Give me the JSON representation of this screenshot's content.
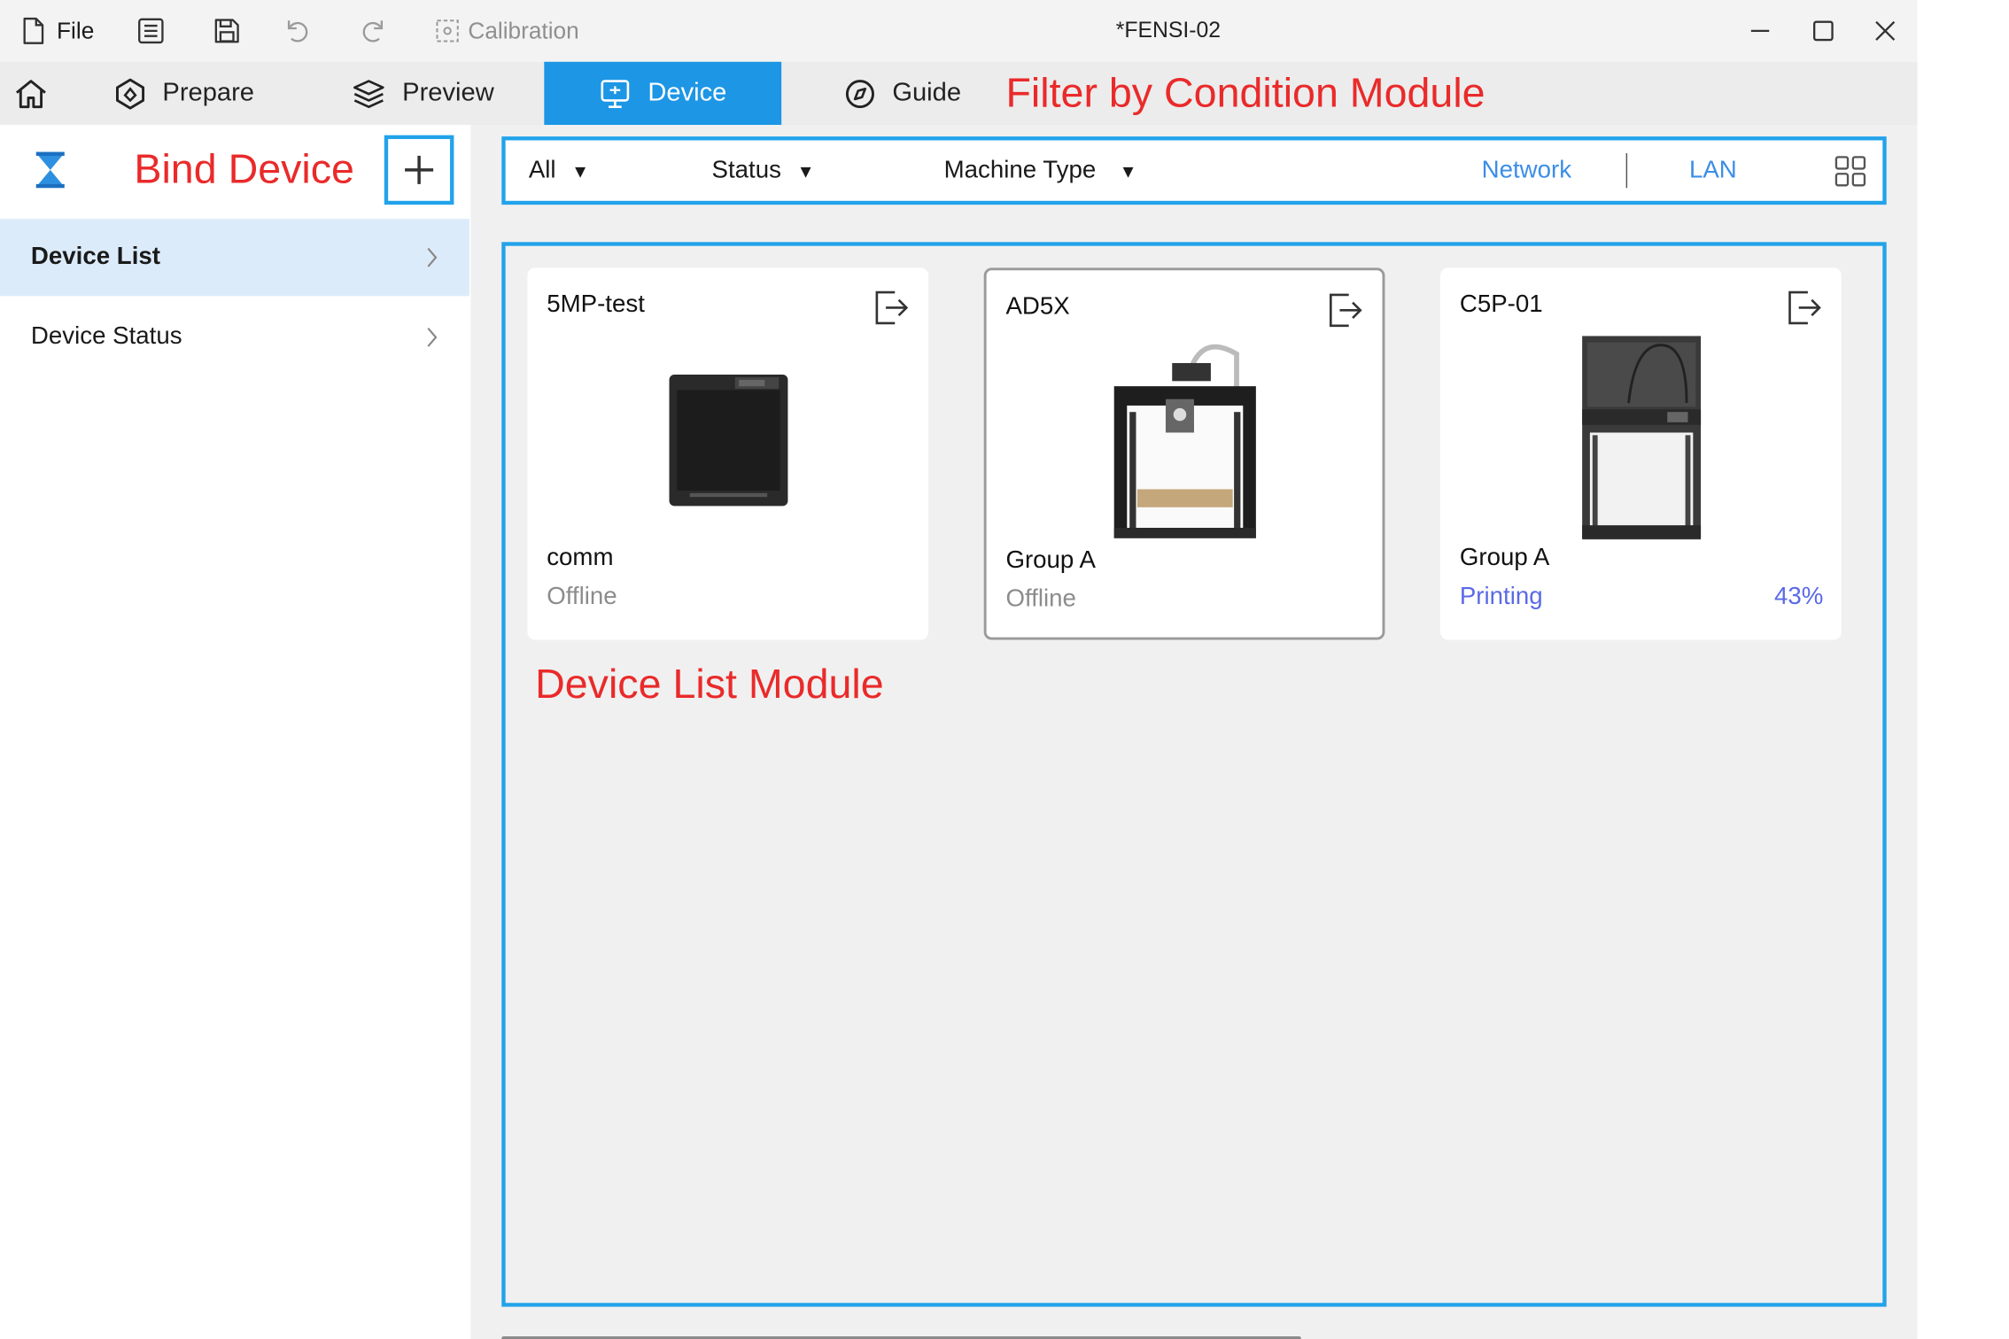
{
  "titlebar": {
    "file_label": "File",
    "calibration_label": "Calibration",
    "window_title": "*FENSI-02"
  },
  "nav": {
    "prepare": "Prepare",
    "preview": "Preview",
    "device": "Device",
    "guide": "Guide",
    "active_color": "#1d96e5"
  },
  "annotations": {
    "filter_module": "Filter by Condition Module",
    "bind_device": "Bind Device",
    "device_list_module": "Device List Module",
    "color": "#ea2a2a",
    "frame_color": "#22a3ea"
  },
  "sidebar": {
    "items": [
      {
        "label": "Device List",
        "active": true
      },
      {
        "label": "Device Status",
        "active": false
      }
    ]
  },
  "filters": {
    "all": "All",
    "status": "Status",
    "machine_type": "Machine Type",
    "network": "Network",
    "lan": "LAN"
  },
  "devices": [
    {
      "name": "5MP-test",
      "group": "comm",
      "status": "Offline",
      "progress": ""
    },
    {
      "name": "AD5X",
      "group": "Group A",
      "status": "Offline",
      "progress": ""
    },
    {
      "name": "C5P-01",
      "group": "Group A",
      "status": "Printing",
      "progress": "43%"
    }
  ]
}
